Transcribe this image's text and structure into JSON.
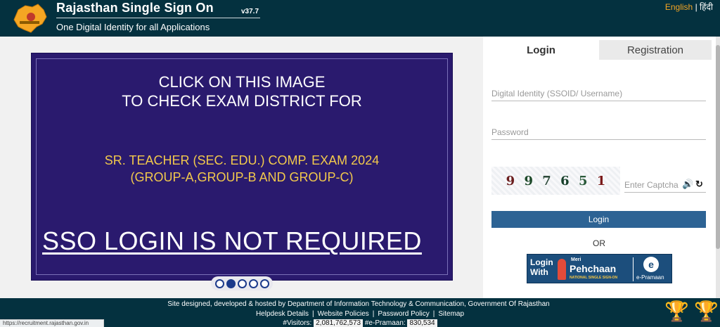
{
  "header": {
    "title": "Rajasthan Single Sign On",
    "version": "v37.7",
    "subtitle": "One Digital Identity for all Applications",
    "lang_english": "English",
    "lang_sep": "|",
    "lang_hindi": "हिंदी",
    "logo_icon": "rajasthan-map-logo"
  },
  "slider": {
    "line1": "CLICK ON THIS IMAGE",
    "line2": "TO CHECK EXAM DISTRICT FOR",
    "exam_line1": "SR. TEACHER (SEC. EDU.) COMP. EXAM 2024",
    "exam_line2": "(GROUP-A,GROUP-B AND GROUP-C)",
    "notice": "SSO LOGIN IS NOT REQUIRED",
    "dots_total": 5,
    "active_dot": 2
  },
  "login": {
    "tab_login": "Login",
    "tab_registration": "Registration",
    "username_placeholder": "Digital Identity (SSOID/ Username)",
    "password_placeholder": "Password",
    "captcha_digits": [
      "9",
      "9",
      "7",
      "6",
      "5",
      "1"
    ],
    "captcha_placeholder": "Enter Captcha",
    "login_button": "Login",
    "or_text": "OR",
    "pehchaan": {
      "login_with_1": "Login",
      "login_with_2": "With",
      "meri": "Meri",
      "title": "Pehchaan",
      "sub": "NATIONAL SINGLE SIGN-ON",
      "epramaan_letter": "e",
      "epramaan_label": "e-Pramaan"
    }
  },
  "footer": {
    "credit": "Site designed, developed & hosted by Department of Information Technology & Communication, Government Of Rajasthan",
    "links": [
      "Helpdesk Details",
      "Website Policies",
      "Password Policy",
      "Sitemap"
    ],
    "visitors_label": "#Visitors:",
    "visitors_count": "2,081,762,573",
    "epramaan_label": "#e-Pramaan:",
    "epramaan_count": "830,534"
  },
  "statusbar": {
    "url": "https://recruitment.rajasthan.gov.in"
  },
  "colors": {
    "header_bg": "#04313f",
    "slide_bg": "#2a1a6e",
    "exam_text": "#f2c94c",
    "login_button": "#2d6394",
    "lang_active": "#f5a623"
  }
}
